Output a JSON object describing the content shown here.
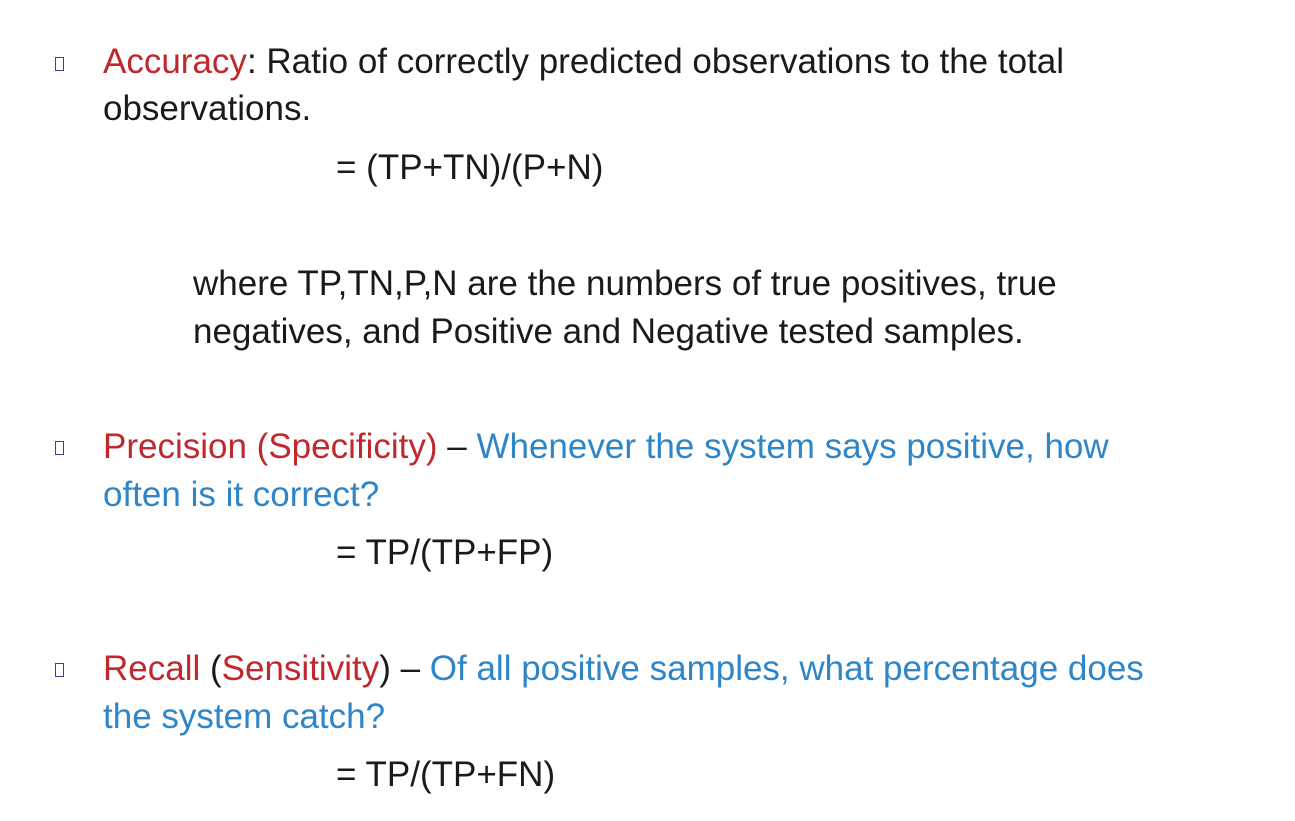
{
  "accuracy": {
    "term": "Accuracy",
    "desc_line1": ": Ratio of correctly predicted observations to the total",
    "desc_line2": "observations.",
    "formula": "= (TP+TN)/(P+N)",
    "note_line1": "where TP,TN,P,N are the numbers of true positives, true",
    "note_line2": "negatives, and  Positive and Negative tested samples."
  },
  "precision": {
    "term": "Precision (Specificity)",
    "dash": " – ",
    "question_line1": "Whenever the system says positive, how",
    "question_line2": "often is it correct?",
    "formula": "= TP/(TP+FP)"
  },
  "recall": {
    "term": "Recall",
    "open_paren": " (",
    "alt_term": "Sensitivity",
    "close_paren_dash": ") – ",
    "question_line1": "Of all positive samples, what percentage does",
    "question_line2": "the system catch?",
    "formula": "= TP/(TP+FN)"
  },
  "colors": {
    "term": "#c0282e",
    "question": "#2e86c8",
    "body": "#1a1a1a",
    "bullet": "#3b3f8f"
  },
  "icons": {
    "bullet": "square-bullet-icon"
  }
}
